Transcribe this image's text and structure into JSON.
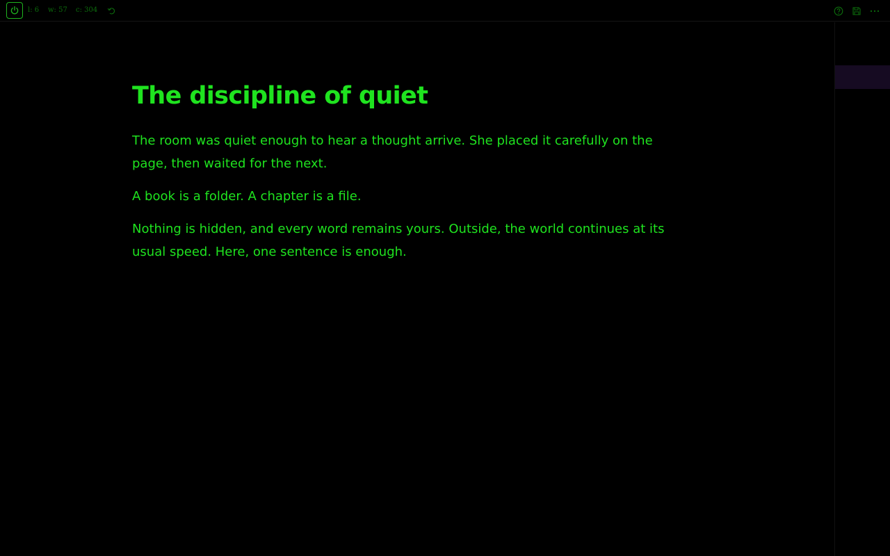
{
  "toolbar": {
    "lines_stat": "l: 6",
    "words_stat": "w: 57",
    "chars_stat": "c: 304",
    "icons": {
      "power": "power-icon",
      "undo": "undo-icon",
      "help": "help-icon",
      "save": "save-icon",
      "more": "more-icon"
    }
  },
  "document": {
    "title": "The discipline of quiet",
    "paragraphs": [
      "The room was quiet enough to hear a thought arrive. She placed it carefully on the page, then waited for the next.",
      "A book is a folder. A chapter is a file.",
      "Nothing is hidden, and every word remains yours. Outside, the world continues at its usual speed. Here, one sentence is enough."
    ]
  },
  "colors": {
    "background": "#000000",
    "text": "#1fe31f",
    "toolbar_text": "#0c6e0c",
    "sidebar_highlight": "#160b22"
  }
}
